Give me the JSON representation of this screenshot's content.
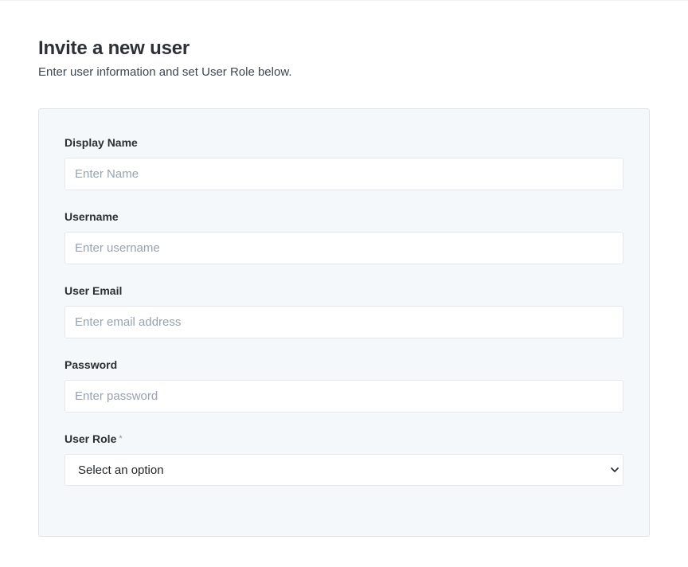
{
  "header": {
    "title": "Invite a new user",
    "subtitle": "Enter user information and set User Role below."
  },
  "form": {
    "display_name": {
      "label": "Display Name",
      "placeholder": "Enter Name",
      "value": ""
    },
    "username": {
      "label": "Username",
      "placeholder": "Enter username",
      "value": ""
    },
    "email": {
      "label": "User Email",
      "placeholder": "Enter email address",
      "value": ""
    },
    "password": {
      "label": "Password",
      "placeholder": "Enter password",
      "value": ""
    },
    "user_role": {
      "label": "User Role",
      "required_marker": "*",
      "selected": "Select an option"
    }
  },
  "icons": {
    "user_role_dropdown": "chevron-down-icon"
  },
  "colors": {
    "card_background": "#f5f8fb",
    "card_border": "#dfe4ea",
    "placeholder_text": "#98a2b0",
    "title_text": "#2d3136"
  }
}
